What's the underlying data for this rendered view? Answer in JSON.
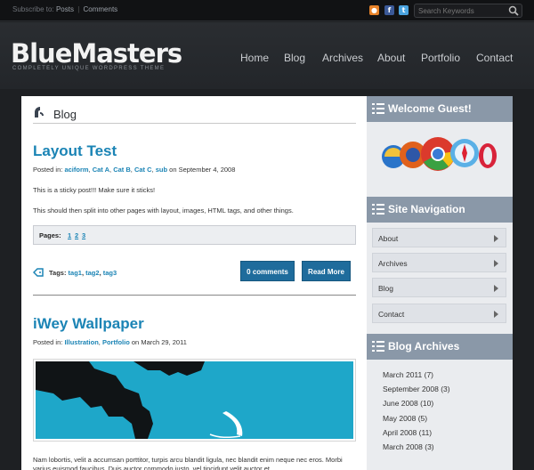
{
  "topbar": {
    "subscribe_label": "Subscribe to:",
    "posts_link": "Posts",
    "separator": "|",
    "comments_link": "Comments",
    "search_placeholder": "Search Keywords"
  },
  "header": {
    "logo": "BlueMasters",
    "tagline": "COMPLETELY UNIQUE WORDPRESS THEME",
    "nav": [
      "Home",
      "Blog",
      "Archives",
      "About",
      "Portfolio",
      "Contact"
    ]
  },
  "main": {
    "section_title": "Blog",
    "post1": {
      "title": "Layout Test",
      "posted_in_label": "Posted in:",
      "categories": [
        "aciform",
        "Cat A",
        "Cat B",
        "Cat C",
        "sub"
      ],
      "date_text": "on September 4, 2008",
      "paragraph1": "This is a sticky post!!! Make sure it sticks!",
      "paragraph2": "This should then split into other pages with layout, images, HTML tags, and other things.",
      "pages_label": "Pages:",
      "pages": [
        "1",
        "2",
        "3"
      ],
      "tags_label": "Tags:",
      "tags": [
        "tag1",
        "tag2",
        "tag3"
      ],
      "comments_button": "0 comments",
      "read_more_button": "Read More"
    },
    "post2": {
      "title": "iWey Wallpaper",
      "posted_in_label": "Posted in:",
      "categories": [
        "Illustration",
        "Portfolio"
      ],
      "date_text": "on March 29, 2011",
      "excerpt": "Nam lobortis, velit a accumsan porttitor, turpis arcu blandit ligula, nec blandit enim neque nec eros. Morbi varius euismod faucibus. Duis auctor commodo justo, vel tincidunt velit auctor et"
    }
  },
  "sidebar": {
    "welcome_title": "Welcome Guest!",
    "nav_title": "Site Navigation",
    "nav_items": [
      "About",
      "Archives",
      "Blog",
      "Contact"
    ],
    "archives_title": "Blog Archives",
    "archives": [
      "March 2011  (7)",
      "September 2008  (3)",
      "June 2008  (10)",
      "May 2008  (5)",
      "April 2008  (11)",
      "March 2008  (3)"
    ]
  },
  "colors": {
    "accent": "#1b84b5",
    "button": "#1f6c9c",
    "widget_header": "#8a98a8"
  }
}
